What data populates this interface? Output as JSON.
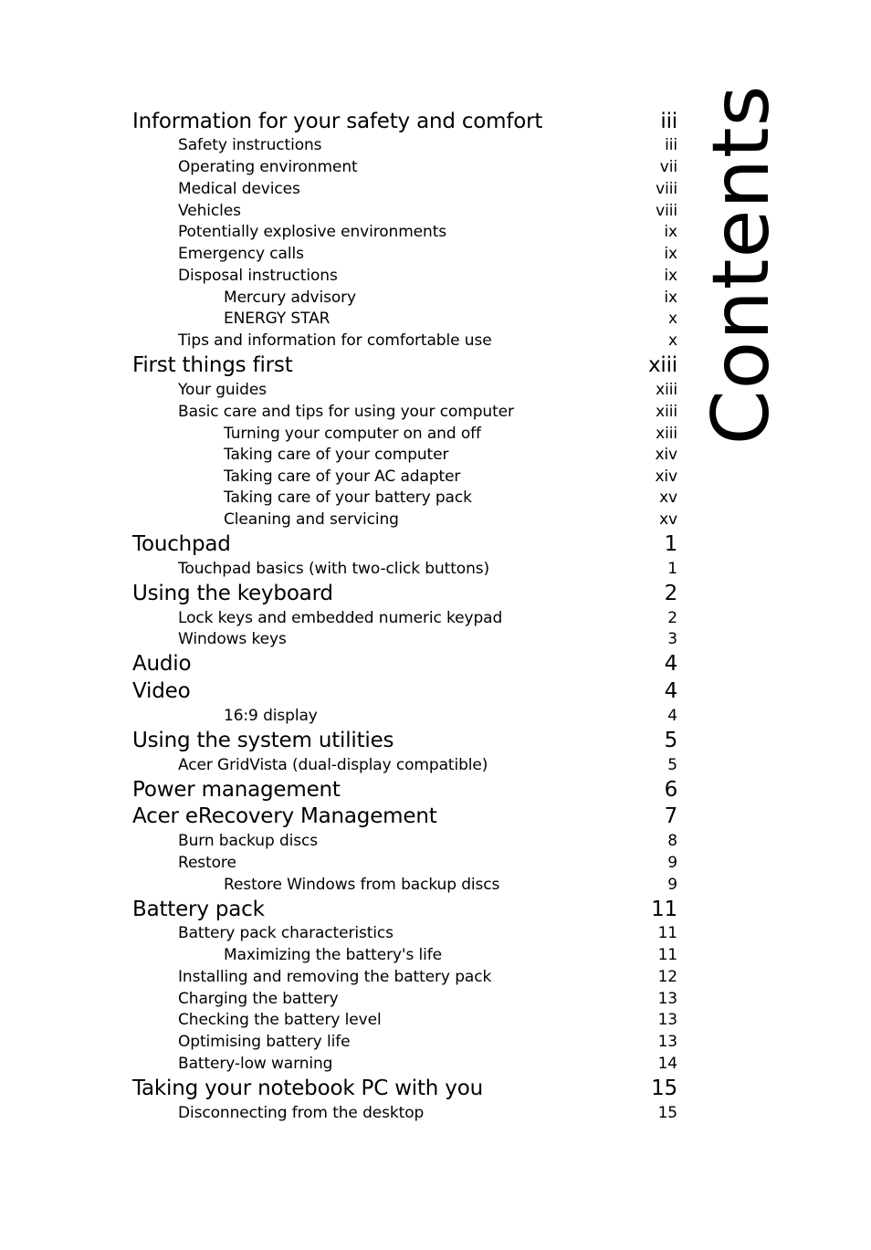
{
  "page_title": "Contents",
  "entries": [
    {
      "level": 1,
      "title": "Information for your safety and comfort",
      "page": "iii"
    },
    {
      "level": 2,
      "title": "Safety instructions",
      "page": "iii"
    },
    {
      "level": 2,
      "title": "Operating environment",
      "page": "vii"
    },
    {
      "level": 2,
      "title": "Medical devices",
      "page": "viii"
    },
    {
      "level": 2,
      "title": "Vehicles",
      "page": "viii"
    },
    {
      "level": 2,
      "title": "Potentially explosive environments",
      "page": "ix"
    },
    {
      "level": 2,
      "title": "Emergency calls",
      "page": "ix"
    },
    {
      "level": 2,
      "title": "Disposal instructions",
      "page": "ix"
    },
    {
      "level": 3,
      "title": "Mercury advisory",
      "page": "ix"
    },
    {
      "level": 3,
      "title": "ENERGY STAR",
      "page": "x"
    },
    {
      "level": 2,
      "title": "Tips and information for comfortable use",
      "page": "x"
    },
    {
      "level": 1,
      "title": "First things first",
      "page": "xiii"
    },
    {
      "level": 2,
      "title": "Your guides",
      "page": "xiii"
    },
    {
      "level": 2,
      "title": "Basic care and tips for using your computer",
      "page": "xiii"
    },
    {
      "level": 3,
      "title": "Turning your computer on and off",
      "page": "xiii"
    },
    {
      "level": 3,
      "title": "Taking care of your computer",
      "page": "xiv"
    },
    {
      "level": 3,
      "title": "Taking care of your AC adapter",
      "page": "xiv"
    },
    {
      "level": 3,
      "title": "Taking care of your battery pack",
      "page": "xv"
    },
    {
      "level": 3,
      "title": "Cleaning and servicing",
      "page": "xv"
    },
    {
      "level": 1,
      "title": "Touchpad",
      "page": "1"
    },
    {
      "level": 2,
      "title": "Touchpad basics (with two-click buttons)",
      "page": "1"
    },
    {
      "level": 1,
      "title": "Using the keyboard",
      "page": "2"
    },
    {
      "level": 2,
      "title": "Lock keys and embedded numeric keypad",
      "page": "2"
    },
    {
      "level": 2,
      "title": "Windows keys",
      "page": "3"
    },
    {
      "level": 1,
      "title": "Audio",
      "page": "4"
    },
    {
      "level": 1,
      "title": "Video",
      "page": "4"
    },
    {
      "level": 3,
      "title": "16:9 display",
      "page": "4"
    },
    {
      "level": 1,
      "title": "Using the system utilities",
      "page": "5"
    },
    {
      "level": 2,
      "title": "Acer GridVista (dual-display compatible)",
      "page": "5"
    },
    {
      "level": 1,
      "title": "Power management",
      "page": "6"
    },
    {
      "level": 1,
      "title": "Acer eRecovery Management",
      "page": "7"
    },
    {
      "level": 2,
      "title": "Burn backup discs",
      "page": "8"
    },
    {
      "level": 2,
      "title": "Restore",
      "page": "9"
    },
    {
      "level": 3,
      "title": "Restore Windows from backup discs",
      "page": "9"
    },
    {
      "level": 1,
      "title": "Battery pack",
      "page": "11"
    },
    {
      "level": 2,
      "title": "Battery pack characteristics",
      "page": "11"
    },
    {
      "level": 3,
      "title": "Maximizing the battery's life",
      "page": "11"
    },
    {
      "level": 2,
      "title": "Installing and removing the battery pack",
      "page": "12"
    },
    {
      "level": 2,
      "title": "Charging the battery",
      "page": "13"
    },
    {
      "level": 2,
      "title": "Checking the battery level",
      "page": "13"
    },
    {
      "level": 2,
      "title": "Optimising battery life",
      "page": "13"
    },
    {
      "level": 2,
      "title": "Battery-low warning",
      "page": "14"
    },
    {
      "level": 1,
      "title": "Taking your notebook PC with you",
      "page": "15"
    },
    {
      "level": 2,
      "title": "Disconnecting from the desktop",
      "page": "15"
    }
  ]
}
